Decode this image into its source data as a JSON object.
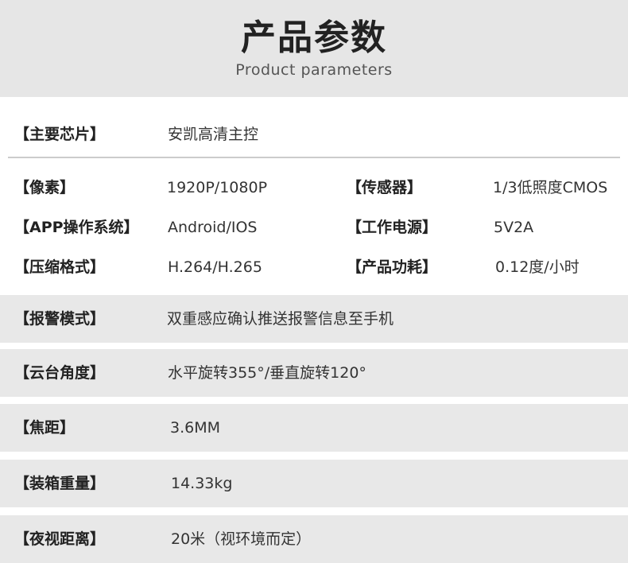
{
  "header": {
    "title": "产品参数",
    "subtitle": "Product parameters"
  },
  "chip": {
    "label": "【主要芯片】",
    "value": "安凯高清主控"
  },
  "specs": {
    "pixels": {
      "label": "【像素】",
      "value": "1920P/1080P"
    },
    "sensor": {
      "label": "【传感器】",
      "value": "1/3低照度CMOS"
    },
    "app_os": {
      "label": "【APP操作系统】",
      "value": "Android/IOS"
    },
    "power": {
      "label": "【工作电源】",
      "value": "5V2A"
    },
    "compression": {
      "label": "【压缩格式】",
      "value": "H.264/H.265"
    },
    "consumption": {
      "label": "【产品功耗】",
      "value": "0.12度/小时"
    }
  },
  "bands": {
    "alarm": {
      "label": "【报警模式】",
      "value": "双重感应确认推送报警信息至手机"
    },
    "ptz": {
      "label": "【云台角度】",
      "value": "水平旋转355°/垂直旋转120°"
    },
    "focal": {
      "label": "【焦距】",
      "value": "3.6MM"
    },
    "weight": {
      "label": "【装箱重量】",
      "value": "14.33kg"
    },
    "night": {
      "label": "【夜视距离】",
      "value": "20米（视环境而定）"
    }
  }
}
